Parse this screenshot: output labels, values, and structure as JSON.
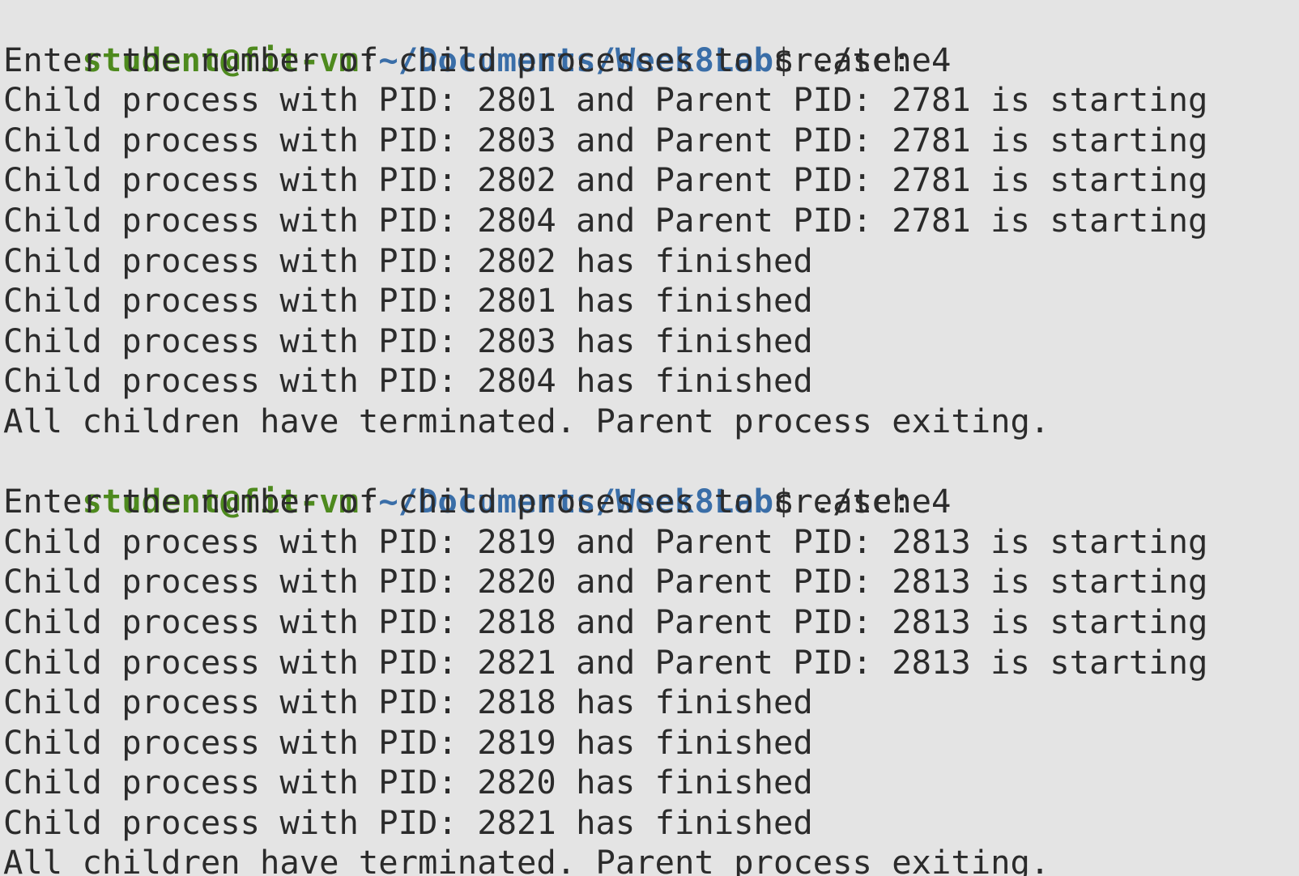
{
  "colors": {
    "background": "#e4e4e4",
    "text": "#2b2b2b",
    "prompt_user": "#4e8a1e",
    "prompt_path": "#3a6ea8"
  },
  "sessions": [
    {
      "prompt": {
        "user_host": "student@fit-vm",
        "separator": ":",
        "path": "~/Documents/Week8Lab",
        "dollar": "$",
        "command": " ./sche"
      },
      "output": [
        "Enter the number of child processes to create: 4",
        "Child process with PID: 2801 and Parent PID: 2781 is starting",
        "Child process with PID: 2803 and Parent PID: 2781 is starting",
        "Child process with PID: 2802 and Parent PID: 2781 is starting",
        "Child process with PID: 2804 and Parent PID: 2781 is starting",
        "Child process with PID: 2802 has finished",
        "Child process with PID: 2801 has finished",
        "Child process with PID: 2803 has finished",
        "Child process with PID: 2804 has finished",
        "All children have terminated. Parent process exiting."
      ]
    },
    {
      "prompt": {
        "user_host": "student@fit-vm",
        "separator": ":",
        "path": "~/Documents/Week8Lab",
        "dollar": "$",
        "command": " ./sche"
      },
      "output": [
        "Enter the number of child processes to create: 4",
        "Child process with PID: 2819 and Parent PID: 2813 is starting",
        "Child process with PID: 2820 and Parent PID: 2813 is starting",
        "Child process with PID: 2818 and Parent PID: 2813 is starting",
        "Child process with PID: 2821 and Parent PID: 2813 is starting",
        "Child process with PID: 2818 has finished",
        "Child process with PID: 2819 has finished",
        "Child process with PID: 2820 has finished",
        "Child process with PID: 2821 has finished",
        "All children have terminated. Parent process exiting."
      ]
    }
  ]
}
